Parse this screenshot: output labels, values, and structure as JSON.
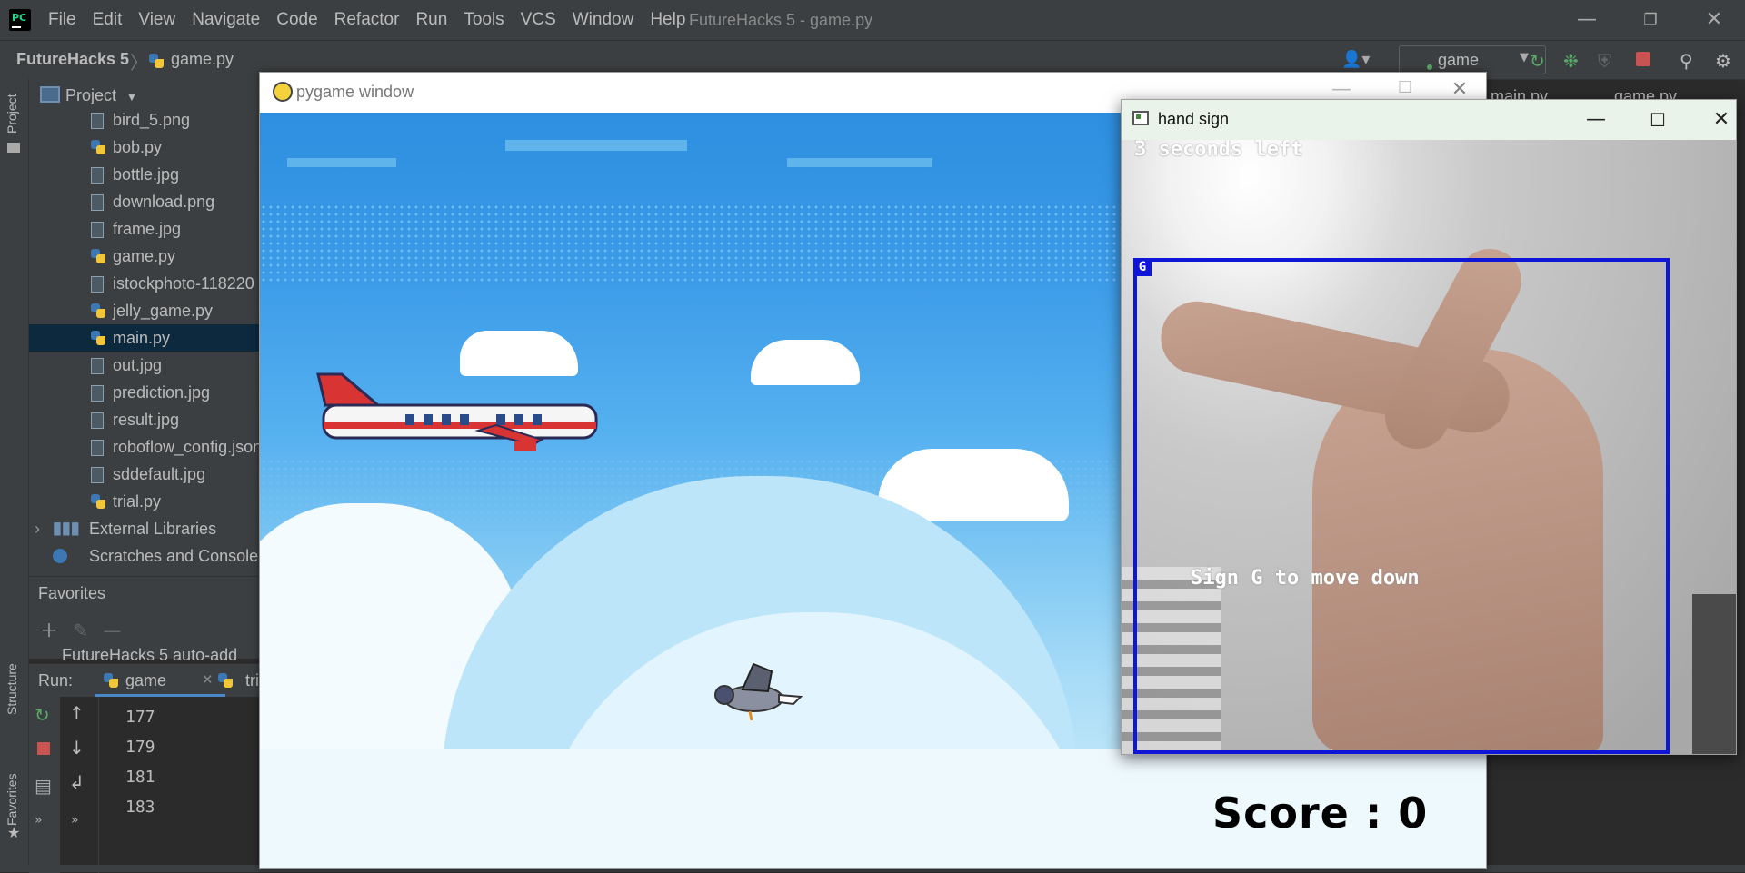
{
  "ide": {
    "logo_text": "PC",
    "menu": [
      "File",
      "Edit",
      "View",
      "Navigate",
      "Code",
      "Refactor",
      "Run",
      "Tools",
      "VCS",
      "Window",
      "Help"
    ],
    "window_title": "FutureHacks 5 - game.py",
    "breadcrumb": {
      "project": "FutureHacks 5",
      "file": "game.py"
    },
    "run_config": "game",
    "left_tabs": {
      "project": "Project",
      "structure": "Structure",
      "favorites": "Favorites"
    },
    "editor_tabs": [
      "main.py",
      "game.py"
    ]
  },
  "project_panel": {
    "title": "Project",
    "files": [
      {
        "name": "bird_5.png",
        "type": "image"
      },
      {
        "name": "bob.py",
        "type": "python"
      },
      {
        "name": "bottle.jpg",
        "type": "image"
      },
      {
        "name": "download.png",
        "type": "image"
      },
      {
        "name": "frame.jpg",
        "type": "image"
      },
      {
        "name": "game.py",
        "type": "python"
      },
      {
        "name": "istockphoto-118220",
        "type": "image"
      },
      {
        "name": "jelly_game.py",
        "type": "python"
      },
      {
        "name": "main.py",
        "type": "python",
        "selected": true
      },
      {
        "name": "out.jpg",
        "type": "image"
      },
      {
        "name": "prediction.jpg",
        "type": "image"
      },
      {
        "name": "result.jpg",
        "type": "image"
      },
      {
        "name": "roboflow_config.json",
        "type": "json"
      },
      {
        "name": "sddefault.jpg",
        "type": "image"
      },
      {
        "name": "trial.py",
        "type": "python"
      }
    ],
    "external_libraries": "External Libraries",
    "scratches": "Scratches and Consoles"
  },
  "favorites": {
    "title": "Favorites",
    "item": "FutureHacks 5  auto-add"
  },
  "run_panel": {
    "label": "Run:",
    "tab": "game",
    "tab2": "tri",
    "lines": [
      "177",
      "179",
      "181",
      "183"
    ]
  },
  "pygame_window": {
    "title": "pygame window",
    "score_text": "Score : 0"
  },
  "hand_sign_window": {
    "title": "hand sign",
    "timer_text": "3 seconds left",
    "box_label": "G",
    "instruction": "Sign G to move down"
  },
  "colors": {
    "ide_bg": "#2b2b2b",
    "ide_panel": "#3c3f41",
    "selection": "#0d293e",
    "bbox": "#1016d8",
    "run_green": "#59a869",
    "stop_red": "#c75450"
  }
}
